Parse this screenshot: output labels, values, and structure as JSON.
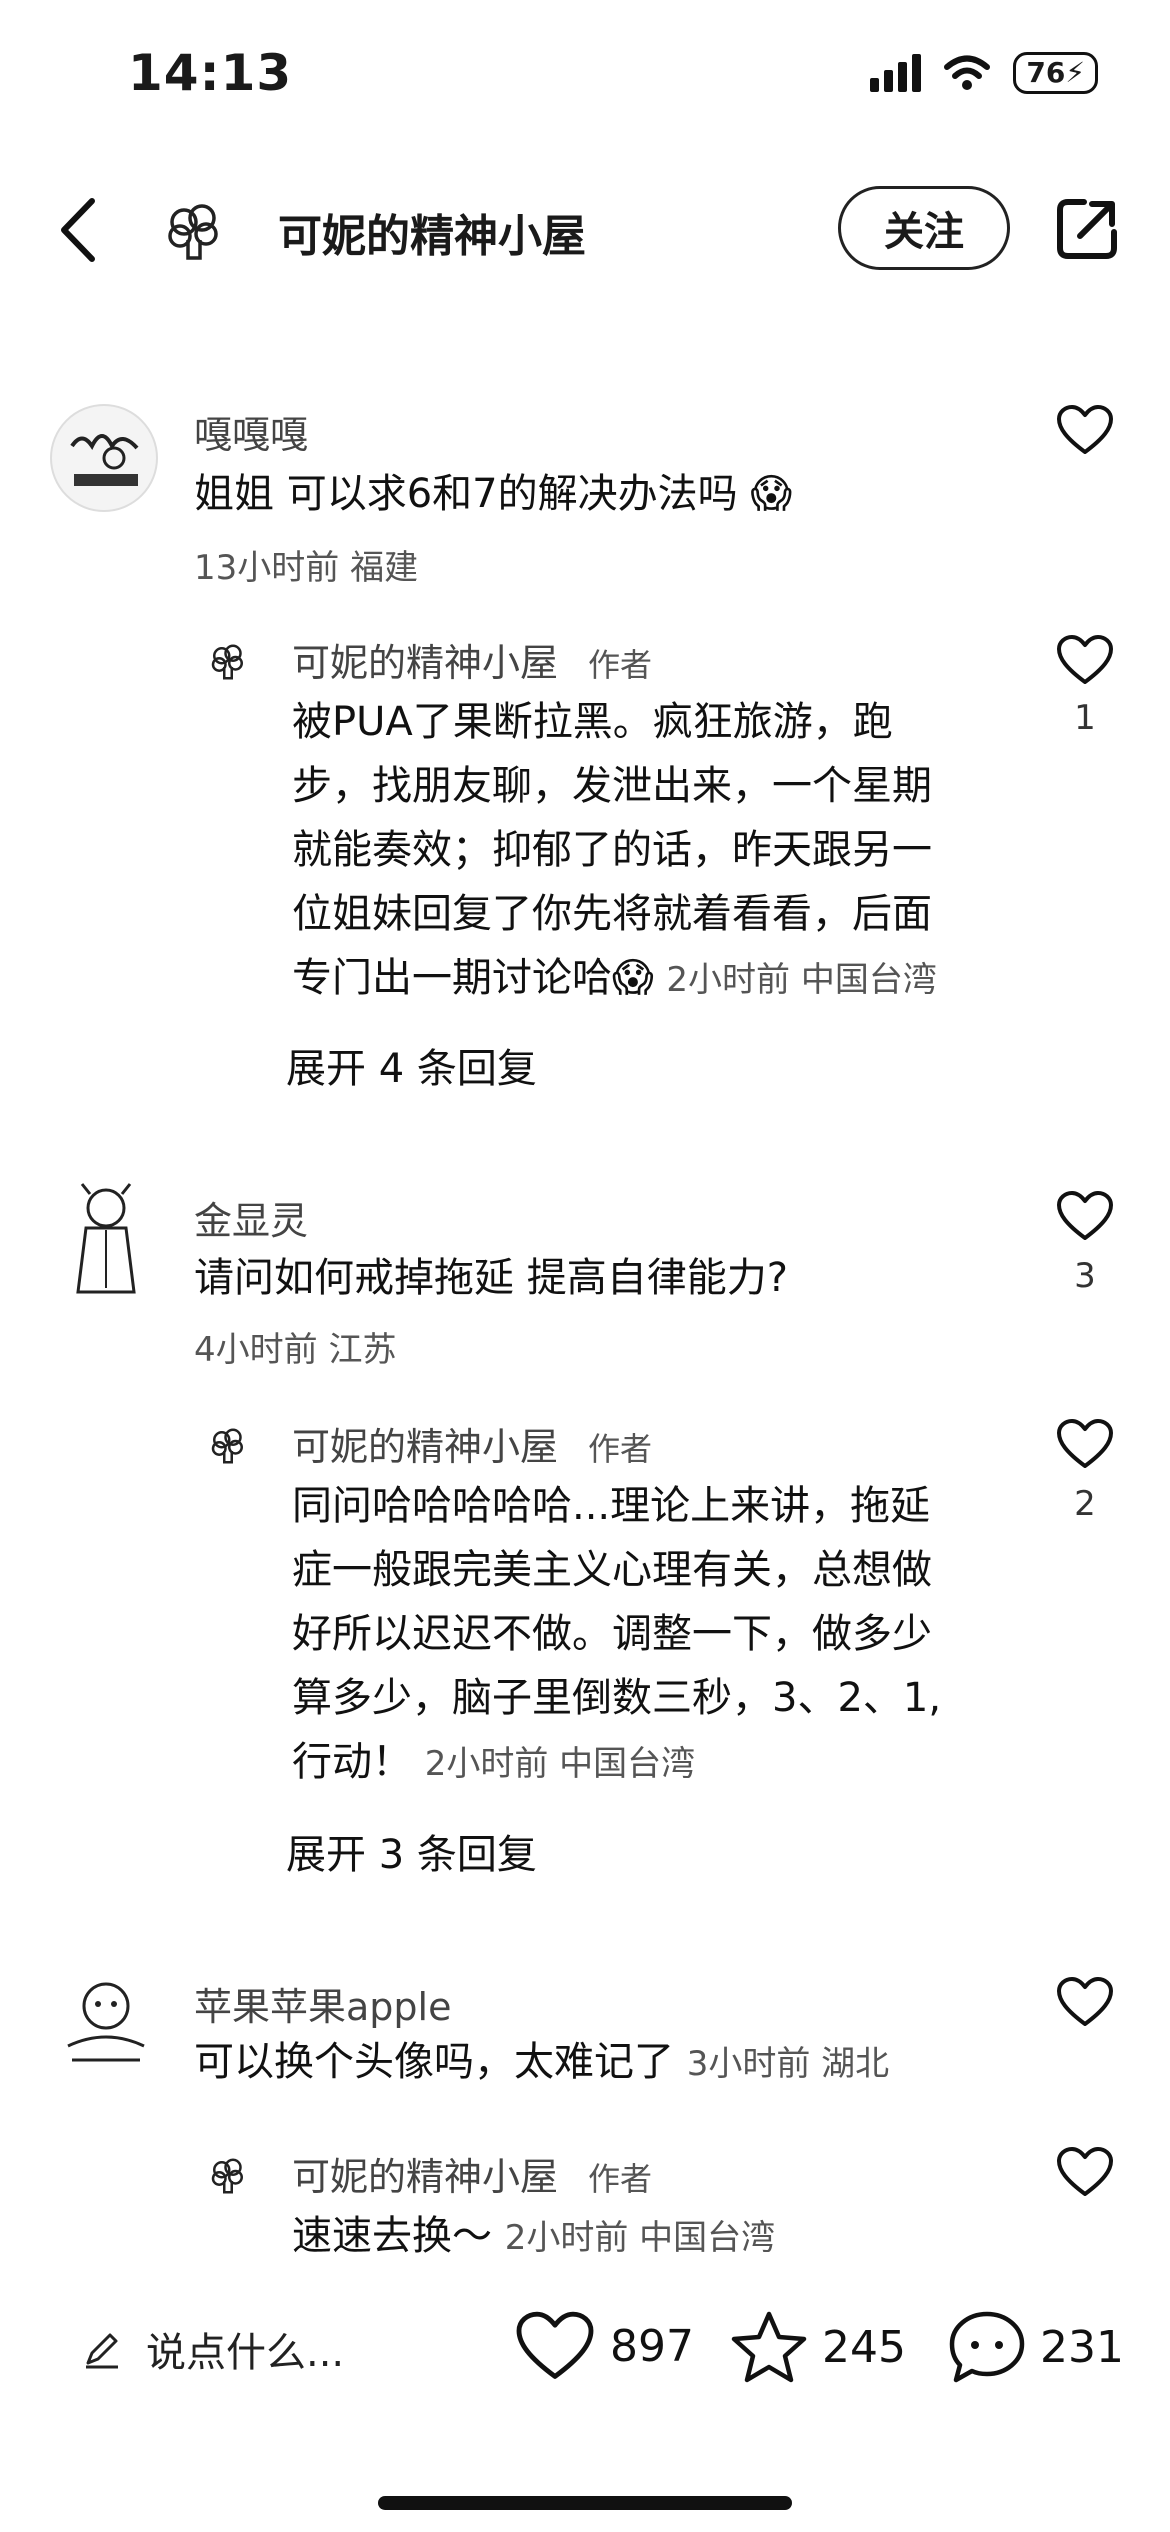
{
  "status_bar": {
    "time": "14:13",
    "battery": "76"
  },
  "header": {
    "title": "可妮的精神小屋",
    "follow_label": "关注"
  },
  "comments": [
    {
      "name": "嘎嘎嘎",
      "text": "姐姐 可以求6和7的解决办法吗",
      "meta": "13小时前 福建",
      "reply": {
        "name": "可妮的精神小屋",
        "author_tag": "作者",
        "lines": [
          "被PUA了果断拉黑。疯狂旅游，跑",
          "步，找朋友聊，发泄出来，一个星期",
          "就能奏效；抑郁了的话，昨天跟另一",
          "位姐妹回复了你先将就着看看，后面",
          "专门出一期讨论哈"
        ],
        "meta": "2小时前 中国台湾",
        "likes": "1"
      },
      "expand_label": "展开 4 条回复"
    },
    {
      "name": "金显灵",
      "text": "请问如何戒掉拖延 提高自律能力?",
      "meta": "4小时前 江苏",
      "likes": "3",
      "reply": {
        "name": "可妮的精神小屋",
        "author_tag": "作者",
        "lines": [
          "同问哈哈哈哈哈...理论上来讲，拖延",
          "症一般跟完美主义心理有关，总想做",
          "好所以迟迟不做。调整一下，做多少",
          "算多少，脑子里倒数三秒，3、2、1,",
          "行动！"
        ],
        "meta": "2小时前 中国台湾",
        "likes": "2"
      },
      "expand_label": "展开 3 条回复"
    },
    {
      "name": "苹果苹果apple",
      "text": "可以换个头像吗，太难记了",
      "meta": "3小时前 湖北",
      "reply": {
        "name": "可妮的精神小屋",
        "author_tag": "作者",
        "text": "速速去换～",
        "meta": "2小时前 中国台湾"
      }
    }
  ],
  "bottom_bar": {
    "placeholder": "说点什么...",
    "likes": "897",
    "stars": "245",
    "comments": "231"
  }
}
